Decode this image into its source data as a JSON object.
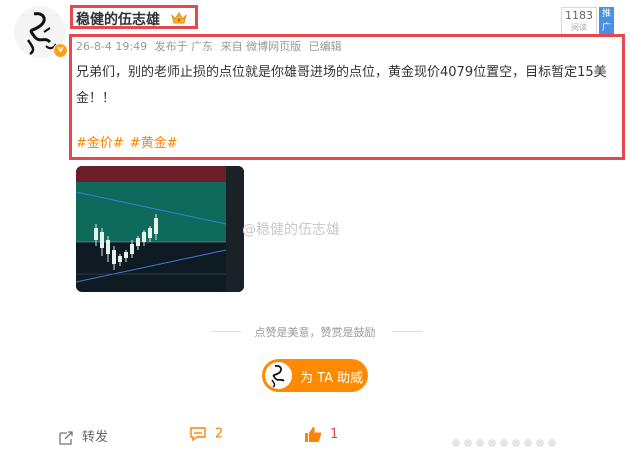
{
  "post": {
    "author": "稳健的伍志雄",
    "meta": {
      "time": "26-8-4 19:49",
      "location": "发布于 广东",
      "source": "来自 微博网页版",
      "edited": "已编辑"
    },
    "text": "兄弟们，别的老师止损的点位就是你雄哥进场的点位，黄金现价4079位置空，目标暂定15美金！！",
    "tags": [
      "#金价#",
      "#黄金#"
    ],
    "watermark": "@稳健的伍志雄"
  },
  "promo": {
    "count": "1183",
    "sub": "阅读",
    "tag": "推广"
  },
  "reward": {
    "motto": "点赞是美意，赞赏是鼓励",
    "button_label": "为 TA 助威"
  },
  "actions": {
    "forward_label": "转发",
    "comment_count": "2",
    "like_count": "1"
  },
  "colors": {
    "accent": "#ff8200",
    "highlight": "#e5484d",
    "button": "#ff8a00"
  }
}
